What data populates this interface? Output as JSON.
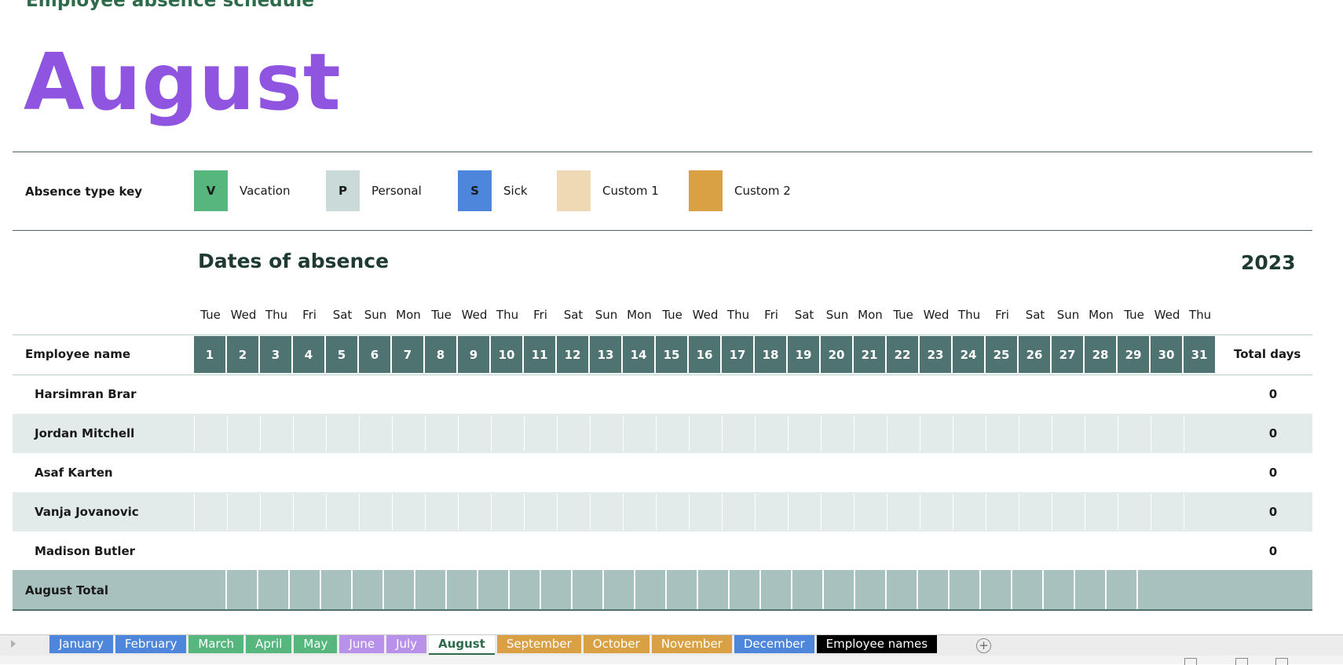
{
  "document": {
    "title": "Employee absence schedule",
    "month": "August",
    "year": "2023"
  },
  "key": {
    "label": "Absence type key",
    "items": [
      {
        "code": "V",
        "name": "Vacation",
        "color": "#57b67d"
      },
      {
        "code": "P",
        "name": "Personal",
        "color": "#c9dad8"
      },
      {
        "code": "S",
        "name": "Sick",
        "color": "#4d86db"
      },
      {
        "code": "",
        "name": "Custom 1",
        "color": "#efd9b5"
      },
      {
        "code": "",
        "name": "Custom 2",
        "color": "#d9a143"
      }
    ]
  },
  "schedule": {
    "section_title": "Dates of absence",
    "name_header": "Employee name",
    "total_header": "Total days",
    "weekdays": [
      "Tue",
      "Wed",
      "Thu",
      "Fri",
      "Sat",
      "Sun",
      "Mon",
      "Tue",
      "Wed",
      "Thu",
      "Fri",
      "Sat",
      "Sun",
      "Mon",
      "Tue",
      "Wed",
      "Thu",
      "Fri",
      "Sat",
      "Sun",
      "Mon",
      "Tue",
      "Wed",
      "Thu",
      "Fri",
      "Sat",
      "Sun",
      "Mon",
      "Tue",
      "Wed",
      "Thu"
    ],
    "days": [
      "1",
      "2",
      "3",
      "4",
      "5",
      "6",
      "7",
      "8",
      "9",
      "10",
      "11",
      "12",
      "13",
      "14",
      "15",
      "16",
      "17",
      "18",
      "19",
      "20",
      "21",
      "22",
      "23",
      "24",
      "25",
      "26",
      "27",
      "28",
      "29",
      "30",
      "31"
    ],
    "employees": [
      {
        "name": "Harsimran Brar",
        "total": "0"
      },
      {
        "name": "Jordan Mitchell",
        "total": "0"
      },
      {
        "name": "Asaf Karten",
        "total": "0"
      },
      {
        "name": "Vanja Jovanovic",
        "total": "0"
      },
      {
        "name": "Madison Butler",
        "total": "0"
      }
    ],
    "footer_label": "August Total"
  },
  "sheet_tabs": [
    {
      "label": "January",
      "color": "#4d86db"
    },
    {
      "label": "February",
      "color": "#4d86db"
    },
    {
      "label": "March",
      "color": "#57b67d"
    },
    {
      "label": "April",
      "color": "#57b67d"
    },
    {
      "label": "May",
      "color": "#57b67d"
    },
    {
      "label": "June",
      "color": "#b892ea"
    },
    {
      "label": "July",
      "color": "#b892ea"
    },
    {
      "label": "August",
      "color": "#ffffff",
      "active": true
    },
    {
      "label": "September",
      "color": "#d9a143"
    },
    {
      "label": "October",
      "color": "#d9a143"
    },
    {
      "label": "November",
      "color": "#d9a143"
    },
    {
      "label": "December",
      "color": "#4d86db"
    },
    {
      "label": "Employee names",
      "color": "#000000"
    }
  ]
}
